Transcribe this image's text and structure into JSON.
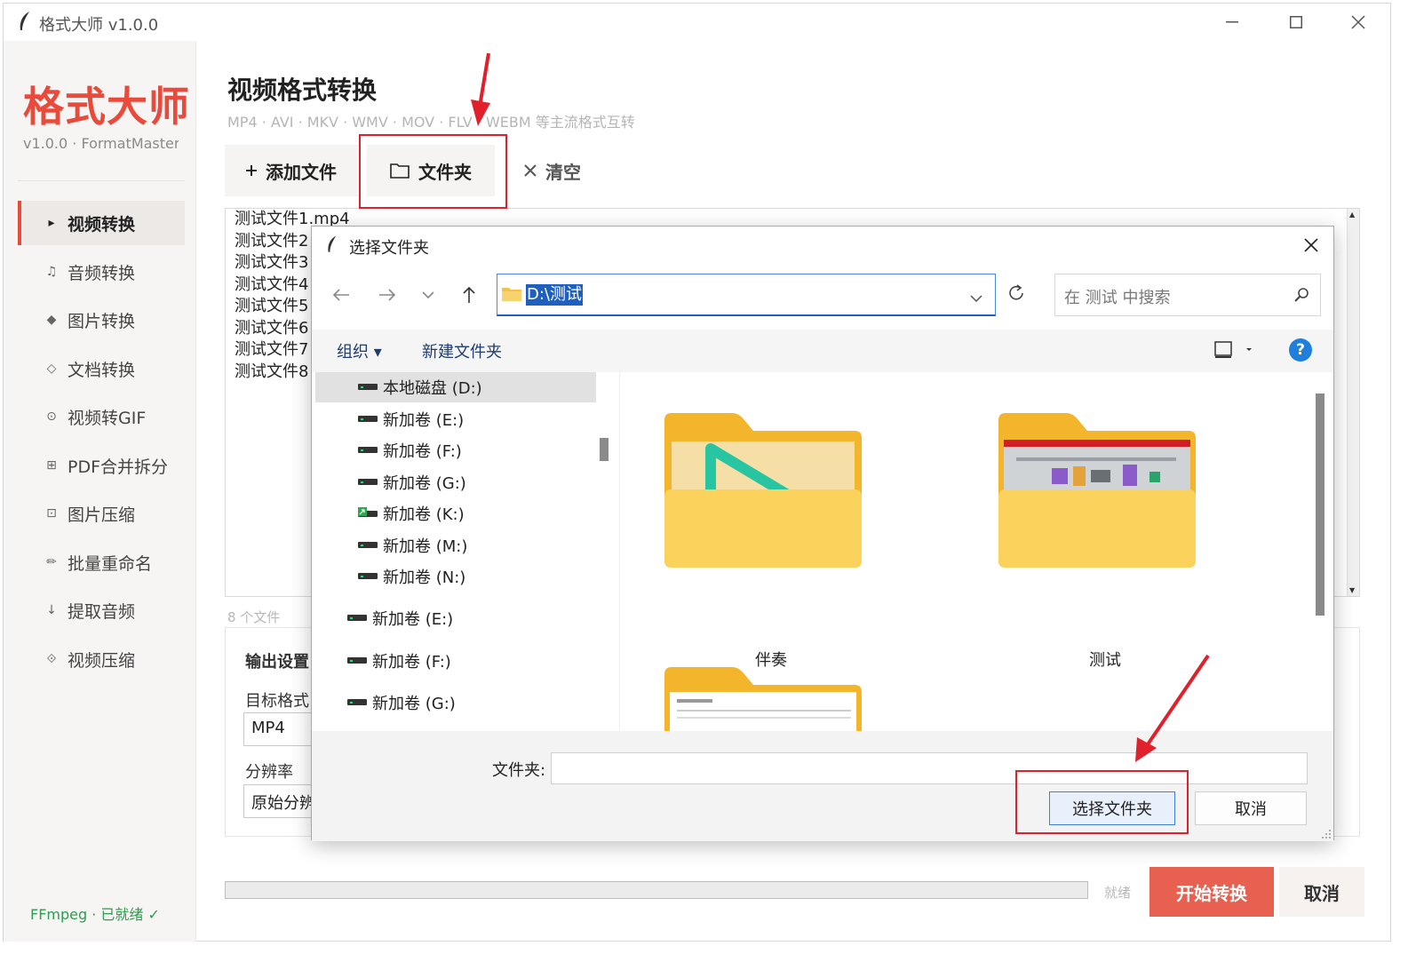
{
  "window": {
    "title": "格式大师 v1.0.0"
  },
  "sidebar": {
    "brand": "格式大师",
    "brand_sub": "v1.0.0 · FormatMaster",
    "items": [
      {
        "label": "视频转换",
        "icon": "▸",
        "active": true
      },
      {
        "label": "音频转换",
        "icon": "♫"
      },
      {
        "label": "图片转换",
        "icon": "◆"
      },
      {
        "label": "文档转换",
        "icon": "◇"
      },
      {
        "label": "视频转GIF",
        "icon": "⊙"
      },
      {
        "label": "PDF合并拆分",
        "icon": "⊞"
      },
      {
        "label": "图片压缩",
        "icon": "⊡"
      },
      {
        "label": "批量重命名",
        "icon": "✏"
      },
      {
        "label": "提取音频",
        "icon": "↓"
      },
      {
        "label": "视频压缩",
        "icon": "⟐"
      }
    ],
    "ffmpeg_status": "FFmpeg · 已就绪 ✓"
  },
  "main": {
    "title": "视频格式转换",
    "subtitle": "MP4 · AVI · MKV · WMV · MOV · FLV · WEBM 等主流格式互转",
    "toolbar": {
      "add_file": "添加文件",
      "folder": "文件夹",
      "clear": "清空"
    },
    "files": [
      "测试文件1.mp4",
      "测试文件2",
      "测试文件3",
      "测试文件4",
      "测试文件5",
      "测试文件6",
      "测试文件7",
      "测试文件8"
    ],
    "file_count": "8 个文件",
    "settings": {
      "title": "输出设置",
      "format_label": "目标格式",
      "format_value": "MP4",
      "resolution_label": "分辨率",
      "resolution_value": "原始分辨率"
    },
    "status": "就绪",
    "start_label": "开始转换",
    "cancel_label": "取消"
  },
  "dialog": {
    "title": "选择文件夹",
    "address": "D:\\测试",
    "search_placeholder": "在 测试 中搜索",
    "organize": "组织 ▾",
    "new_folder": "新建文件夹",
    "help": "?",
    "tree": [
      {
        "label": "本地磁盘 (D:)",
        "selected": true
      },
      {
        "label": "新加卷 (E:)"
      },
      {
        "label": "新加卷 (F:)"
      },
      {
        "label": "新加卷 (G:)"
      },
      {
        "label": "新加卷 (K:)"
      },
      {
        "label": "新加卷 (M:)"
      },
      {
        "label": "新加卷 (N:)"
      },
      {
        "label": "新加卷 (E:)"
      },
      {
        "label": "新加卷 (F:)"
      },
      {
        "label": "新加卷 (G:)"
      }
    ],
    "folders": [
      {
        "name": "伴奏"
      },
      {
        "name": "测试"
      },
      {
        "name": ""
      }
    ],
    "folder_label": "文件夹:",
    "folder_value": "",
    "select_button": "选择文件夹",
    "cancel_button": "取消"
  },
  "colors": {
    "brand": "#e84b3c",
    "accent_blue": "#1f5fbf",
    "start_button": "#e8604f",
    "annotation": "#e0202b",
    "ready_green": "#2e9c4e"
  }
}
